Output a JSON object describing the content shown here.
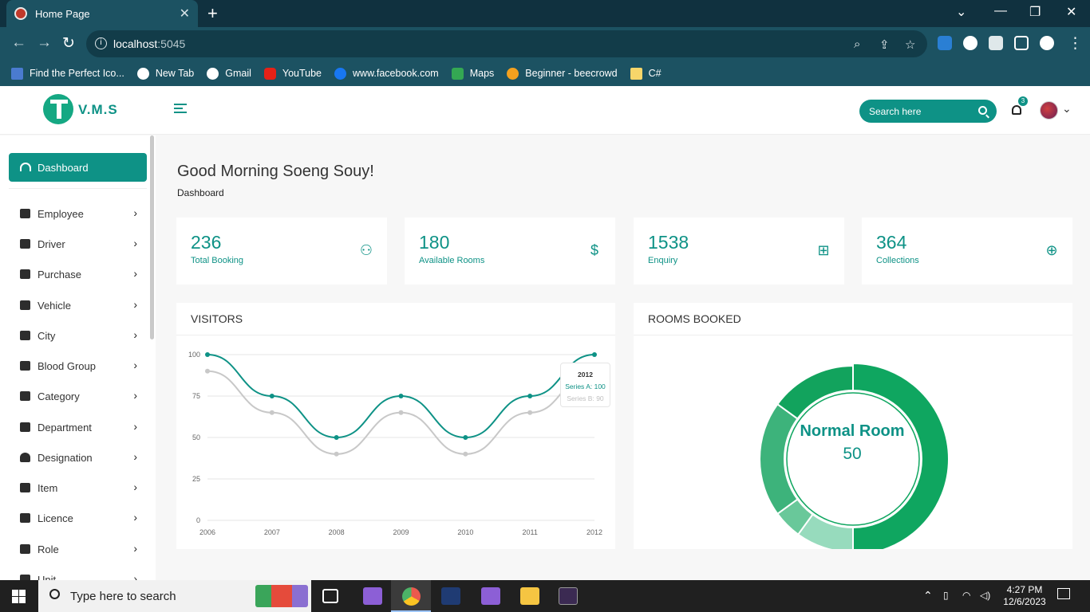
{
  "browser": {
    "tab_title": "Home Page",
    "url_host": "localhost",
    "url_port": ":5045",
    "bookmarks": [
      "Find the Perfect Ico...",
      "New Tab",
      "Gmail",
      "YouTube",
      "www.facebook.com",
      "Maps",
      "Beginner - beecrowd",
      "C#"
    ]
  },
  "app": {
    "logo_text": "V.M.S",
    "search_placeholder": "Search here",
    "notification_count": "3",
    "greeting": "Good Morning Soeng Souy!",
    "breadcrumb": "Dashboard",
    "sidebar": {
      "active": "Dashboard",
      "items": [
        "Employee",
        "Driver",
        "Purchase",
        "Vehicle",
        "City",
        "Blood Group",
        "Category",
        "Department",
        "Designation",
        "Item",
        "Licence",
        "Role",
        "Unit"
      ]
    },
    "stats": [
      {
        "value": "236",
        "label": "Total Booking",
        "icon": "user-plus-icon"
      },
      {
        "value": "180",
        "label": "Available Rooms",
        "icon": "dollar-icon"
      },
      {
        "value": "1538",
        "label": "Enquiry",
        "icon": "file-plus-icon"
      },
      {
        "value": "364",
        "label": "Collections",
        "icon": "globe-icon"
      }
    ],
    "visitors_title": "VISITORS",
    "rooms_title": "ROOMS BOOKED",
    "donut_label": "Normal Room",
    "donut_value": "50",
    "tooltip": {
      "year": "2012",
      "a": "Series A: 100",
      "b": "Series B: 90"
    }
  },
  "chart_data": [
    {
      "type": "line",
      "x": [
        "2006",
        "2007",
        "2008",
        "2009",
        "2010",
        "2011",
        "2012"
      ],
      "series": [
        {
          "name": "Series A",
          "values": [
            100,
            75,
            50,
            75,
            50,
            75,
            100
          ],
          "color": "#0e9286"
        },
        {
          "name": "Series B",
          "values": [
            90,
            65,
            40,
            65,
            40,
            65,
            90
          ],
          "color": "#c8c8c8"
        }
      ],
      "ylim": [
        0,
        100
      ],
      "yticks": [
        0,
        25,
        50,
        75,
        100
      ],
      "grid": true
    },
    {
      "type": "pie",
      "donut": true,
      "values": [
        50,
        10,
        5,
        20,
        15
      ],
      "colors": [
        "#0fa660",
        "#97dbbd",
        "#69c89a",
        "#3db37b",
        "#12a35d"
      ],
      "center_label": "Normal Room",
      "center_value": "50"
    }
  ],
  "taskbar": {
    "search_placeholder": "Type here to search",
    "time": "4:27 PM",
    "date": "12/6/2023"
  }
}
